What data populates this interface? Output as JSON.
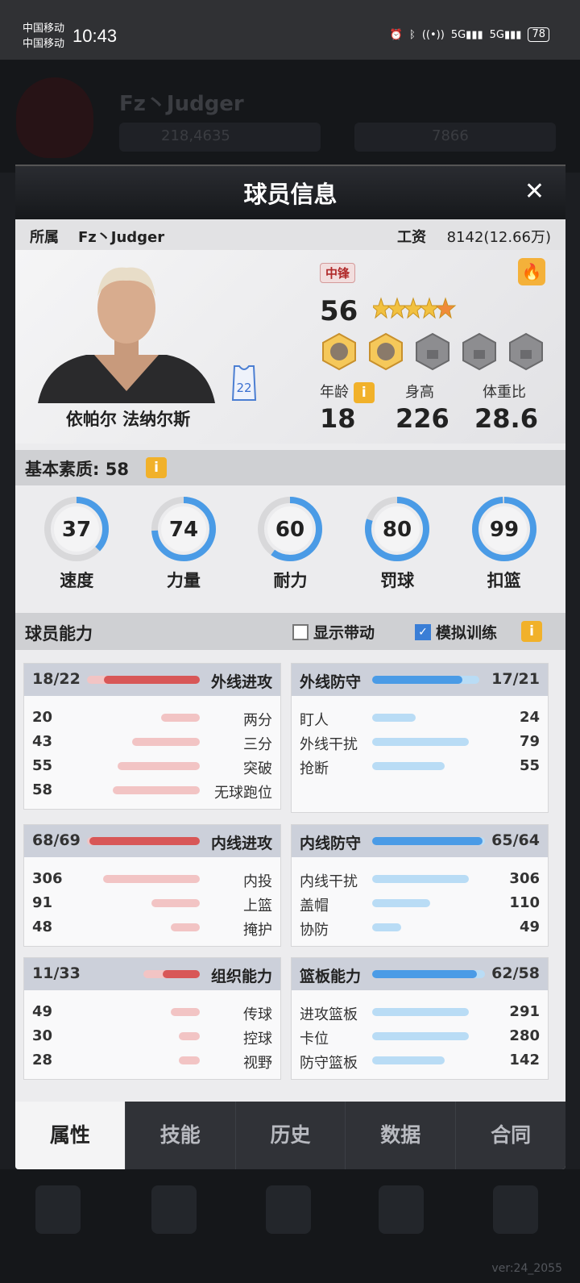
{
  "status": {
    "carrier1": "中国移动",
    "carrier2": "中国移动",
    "time": "10:43",
    "battery": "78"
  },
  "bg": {
    "team_name": "Fz丶Judger",
    "coins": "218,4635",
    "gems": "7866",
    "version": "ver:24_2055"
  },
  "modal": {
    "title": "球员信息"
  },
  "info": {
    "team_label": "所属",
    "team_value": "Fz丶Judger",
    "salary_label": "工资",
    "salary_value": "8142(12.66万)"
  },
  "player": {
    "name": "依帕尔 法纳尔斯",
    "position": "中锋",
    "overall": "56",
    "jersey": "22",
    "age_label": "年龄",
    "age": "18",
    "height_label": "身高",
    "height": "226",
    "weight_label": "体重比",
    "weight": "28.6"
  },
  "base": {
    "label": "基本素质: 58"
  },
  "attributes": [
    {
      "label": "速度",
      "value": "37",
      "pct": 37
    },
    {
      "label": "力量",
      "value": "74",
      "pct": 74
    },
    {
      "label": "耐力",
      "value": "60",
      "pct": 60
    },
    {
      "label": "罚球",
      "value": "80",
      "pct": 80
    },
    {
      "label": "扣篮",
      "value": "99",
      "pct": 99
    }
  ],
  "ability": {
    "title": "球员能力",
    "show_drive": "显示带动",
    "sim_train": "模拟训练"
  },
  "cards": [
    {
      "title": "外线进攻",
      "score": "18/22",
      "side": "left",
      "color": "red",
      "bar": [
        0.85,
        1
      ],
      "rows": [
        {
          "label": "两分",
          "value": "20",
          "p": 0.4
        },
        {
          "label": "三分",
          "value": "43",
          "p": 0.7
        },
        {
          "label": "突破",
          "value": "55",
          "p": 0.85
        },
        {
          "label": "无球跑位",
          "value": "58",
          "p": 0.9
        }
      ]
    },
    {
      "title": "外线防守",
      "score": "17/21",
      "side": "right",
      "color": "blue",
      "bar": [
        0.8,
        0.95
      ],
      "rows": [
        {
          "label": "盯人",
          "value": "24",
          "p": 0.45
        },
        {
          "label": "外线干扰",
          "value": "79",
          "p": 1
        },
        {
          "label": "抢断",
          "value": "55",
          "p": 0.75
        }
      ]
    },
    {
      "title": "内线进攻",
      "score": "68/69",
      "side": "left",
      "color": "red",
      "bar": [
        0.98,
        1
      ],
      "rows": [
        {
          "label": "内投",
          "value": "306",
          "p": 1
        },
        {
          "label": "上篮",
          "value": "91",
          "p": 0.5
        },
        {
          "label": "掩护",
          "value": "48",
          "p": 0.3
        }
      ]
    },
    {
      "title": "内线防守",
      "score": "65/64",
      "side": "right",
      "color": "blue",
      "bar": [
        0.98,
        1
      ],
      "rows": [
        {
          "label": "内线干扰",
          "value": "306",
          "p": 1
        },
        {
          "label": "盖帽",
          "value": "110",
          "p": 0.6
        },
        {
          "label": "协防",
          "value": "49",
          "p": 0.3
        }
      ]
    },
    {
      "title": "组织能力",
      "score": "11/33",
      "side": "left",
      "color": "red",
      "bar": [
        0.33,
        0.5
      ],
      "rows": [
        {
          "label": "传球",
          "value": "49",
          "p": 0.3
        },
        {
          "label": "控球",
          "value": "30",
          "p": 0.22
        },
        {
          "label": "视野",
          "value": "28",
          "p": 0.22
        }
      ]
    },
    {
      "title": "篮板能力",
      "score": "62/58",
      "side": "right",
      "color": "blue",
      "bar": [
        0.93,
        1
      ],
      "rows": [
        {
          "label": "进攻篮板",
          "value": "291",
          "p": 1
        },
        {
          "label": "卡位",
          "value": "280",
          "p": 1
        },
        {
          "label": "防守篮板",
          "value": "142",
          "p": 0.75
        }
      ]
    }
  ],
  "tabs": [
    "属性",
    "技能",
    "历史",
    "数据",
    "合同"
  ]
}
